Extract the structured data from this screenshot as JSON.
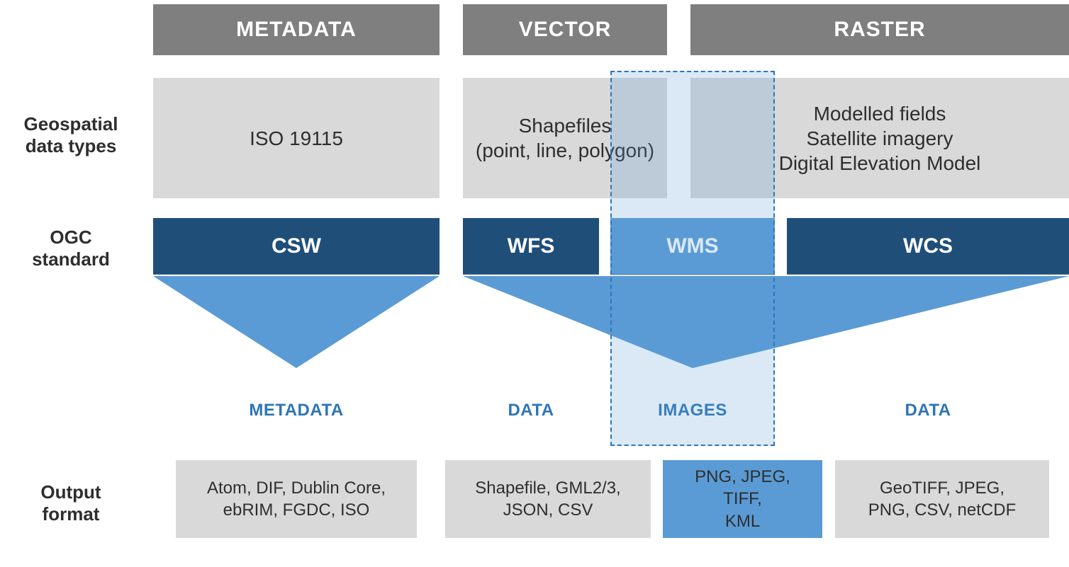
{
  "rows": {
    "datatypes": "Geospatial\ndata types",
    "ogc": "OGC\nstandard",
    "output": "Output\nformat"
  },
  "cols": {
    "metadata": {
      "header": "METADATA",
      "datatype": "ISO 19115",
      "ogc": "CSW",
      "outkind": "METADATA",
      "formats": "Atom, DIF, Dublin Core,\nebRIM, FGDC, ISO"
    },
    "vector": {
      "header": "VECTOR",
      "datatype": "Shapefiles\n(point, line, polygon)",
      "ogc_wfs": "WFS",
      "outkind_wfs": "DATA",
      "formats_wfs": "Shapefile, GML2/3,\nJSON, CSV",
      "ogc_wms": "WMS",
      "outkind_wms": "IMAGES",
      "formats_wms": "PNG, JPEG, TIFF,\nKML"
    },
    "raster": {
      "header": "RASTER",
      "datatype": "Modelled fields\nSatellite imagery\nDigital Elevation Model",
      "ogc": "WCS",
      "outkind": "DATA",
      "formats": "GeoTIFF, JPEG,\nPNG, CSV, netCDF"
    }
  }
}
